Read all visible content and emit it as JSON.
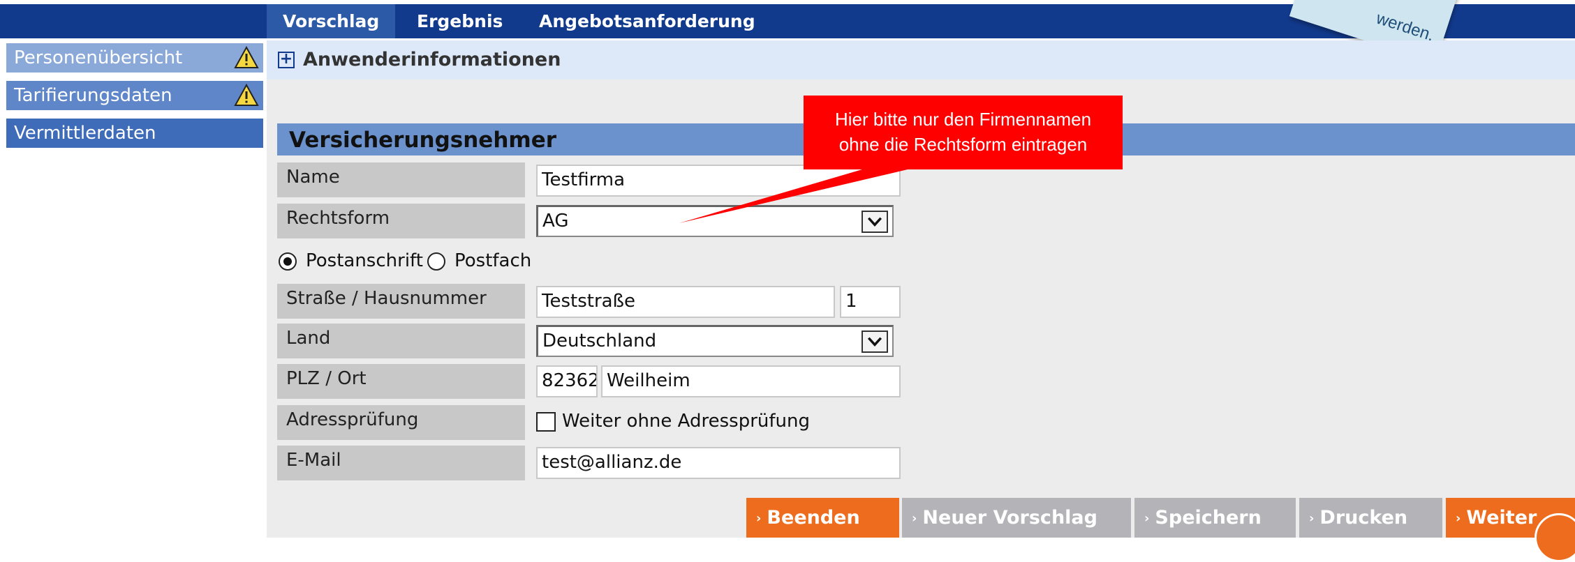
{
  "nav": {
    "tabs": [
      {
        "label": "Vorschlag",
        "active": true
      },
      {
        "label": "Ergebnis",
        "active": false
      },
      {
        "label": "Angebotsanforderung",
        "active": false
      }
    ]
  },
  "sidebar": {
    "items": [
      {
        "label": "Personenübersicht",
        "warning": true,
        "color": "#8aa8d8"
      },
      {
        "label": "Tarifierungsdaten",
        "warning": true,
        "color": "#5e86c8"
      },
      {
        "label": "Vermittlerdaten",
        "warning": false,
        "color": "#3f6cb8"
      }
    ]
  },
  "userinfo": {
    "label": "Anwenderinformationen"
  },
  "section": {
    "title": "Versicherungsnehmer"
  },
  "form": {
    "name_label": "Name",
    "name_value": "Testfirma",
    "rechtsform_label": "Rechtsform",
    "rechtsform_value": "AG",
    "address_type": {
      "option1": "Postanschrift",
      "option2": "Postfach",
      "selected": "Postanschrift"
    },
    "street_label": "Straße / Hausnummer",
    "street_value": "Teststraße",
    "housenumber_value": "1",
    "country_label": "Land",
    "country_value": "Deutschland",
    "plz_label": "PLZ / Ort",
    "plz_value": "82362",
    "city_value": "Weilheim",
    "check_label": "Adressprüfung",
    "check_text": "Weiter ohne Adressprüfung",
    "check_checked": false,
    "email_label": "E-Mail",
    "email_value": "test@allianz.de"
  },
  "callout": {
    "line1": "Hier bitte nur den Firmennamen",
    "line2": "ohne die Rechtsform eintragen"
  },
  "corner_note": {
    "text": "werden."
  },
  "footer": {
    "buttons": [
      {
        "label": "Beenden",
        "style": "orange"
      },
      {
        "label": "Neuer Vorschlag",
        "style": "grey"
      },
      {
        "label": "Speichern",
        "style": "grey"
      },
      {
        "label": "Drucken",
        "style": "grey"
      },
      {
        "label": "Weiter",
        "style": "orange"
      }
    ]
  },
  "colors": {
    "nav": "#123a8c",
    "accent_orange": "#ee6c1e",
    "callout_red": "#ff0000",
    "section_blue": "#6b92cc"
  }
}
